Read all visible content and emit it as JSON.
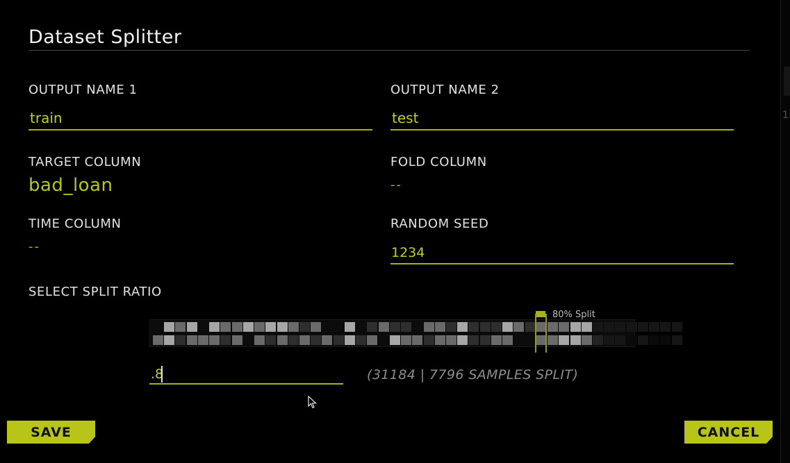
{
  "dialog": {
    "title": "Dataset Splitter"
  },
  "fields": {
    "output_name_1": {
      "label": "OUTPUT NAME 1",
      "value": "train"
    },
    "output_name_2": {
      "label": "OUTPUT NAME 2",
      "value": "test"
    },
    "target_column": {
      "label": "TARGET COLUMN",
      "value": "bad_loan"
    },
    "fold_column": {
      "label": "FOLD COLUMN",
      "value": "--"
    },
    "time_column": {
      "label": "TIME COLUMN",
      "value": "--"
    },
    "random_seed": {
      "label": "RANDOM SEED",
      "value": "1234"
    }
  },
  "split": {
    "label": "SELECT SPLIT RATIO",
    "marker_label": "80% Split",
    "ratio": 0.8,
    "ratio_input_value": ".8",
    "samples_text": "(31184 | 7796 SAMPLES SPLIT)",
    "rows": [
      [
        0,
        3,
        2,
        3,
        0,
        3,
        2,
        2,
        3,
        2,
        3,
        3,
        2,
        1,
        2,
        0,
        0,
        3,
        0,
        1,
        2,
        1,
        1,
        0,
        2,
        2,
        1,
        3,
        1,
        1,
        1,
        3,
        2,
        1,
        2,
        2,
        2,
        3,
        3,
        1,
        1,
        1,
        1,
        1,
        1,
        1,
        1
      ],
      [
        2,
        3,
        1,
        2,
        2,
        2,
        1,
        2,
        0,
        2,
        1,
        2,
        1,
        2,
        1,
        2,
        1,
        3,
        1,
        2,
        0,
        3,
        2,
        2,
        1,
        2,
        2,
        3,
        1,
        1,
        2,
        2,
        0,
        0,
        2,
        2,
        3,
        3,
        2,
        2,
        1,
        1,
        0,
        1,
        0,
        0,
        1
      ]
    ]
  },
  "buttons": {
    "save": "SAVE",
    "cancel": "CANCEL"
  },
  "colors": {
    "accent": "#b8c417",
    "accent_text": "#c3cf21",
    "background": "#000000"
  }
}
